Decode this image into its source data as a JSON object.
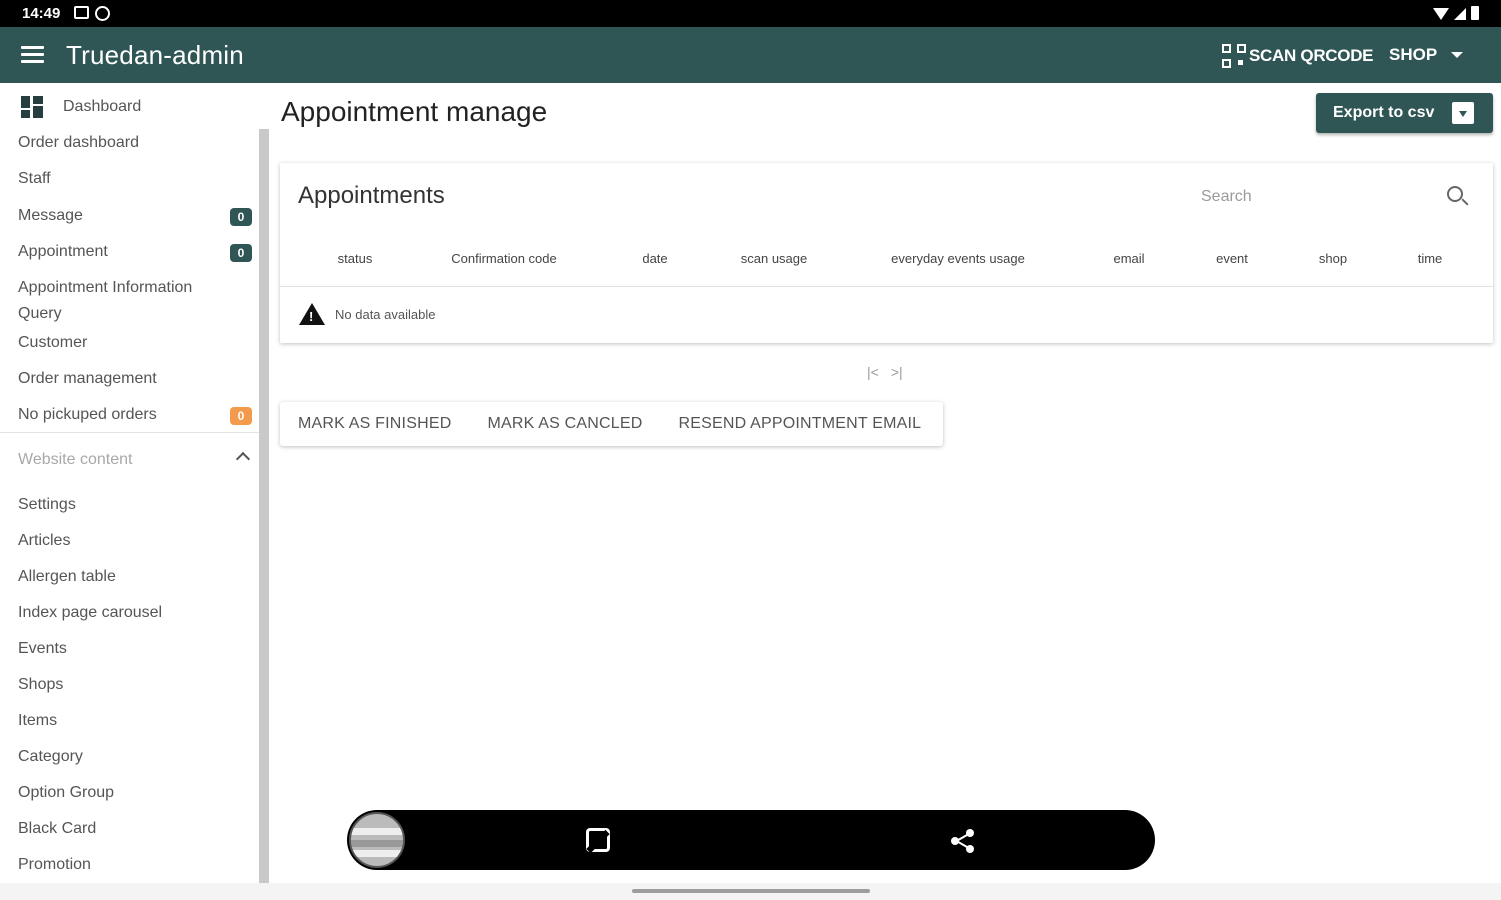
{
  "status_bar": {
    "time": "14:49"
  },
  "appbar": {
    "title": "Truedan-admin",
    "scan_label": "SCAN QRCODE",
    "shop_label": "SHOP",
    "color": "#2f5655"
  },
  "sidebar": {
    "dashboard": "Dashboard",
    "items": [
      {
        "label": "Order dashboard"
      },
      {
        "label": "Staff"
      },
      {
        "label": "Message",
        "badge": "0"
      },
      {
        "label": "Appointment",
        "badge": "0"
      },
      {
        "label": "Appointment Information Query"
      },
      {
        "label": "Customer"
      },
      {
        "label": "Order management"
      },
      {
        "label": "No pickuped orders",
        "badge": "0"
      }
    ],
    "group_label": "Website content",
    "group_items": [
      "Settings",
      "Articles",
      "Allergen table",
      "Index page carousel",
      "Events",
      "Shops",
      "Items",
      "Category",
      "Option Group",
      "Black Card",
      "Promotion"
    ]
  },
  "main": {
    "page_title": "Appointment manage",
    "export_label": "Export to csv",
    "card_title": "Appointments",
    "search_placeholder": "Search",
    "columns": [
      "status",
      "Confirmation code",
      "date",
      "scan usage",
      "everyday events usage",
      "email",
      "event",
      "shop",
      "time"
    ],
    "no_data": "No data available",
    "pager": {
      "first": "|<",
      "last": ">|"
    },
    "actions": [
      "MARK AS FINISHED",
      "MARK AS CANCLED",
      "RESEND APPOINTMENT EMAIL"
    ]
  },
  "icons": [
    "menu-icon",
    "qr-code-icon",
    "chevron-down-icon",
    "dashboard-icon",
    "chevron-up-icon",
    "download-icon",
    "search-icon",
    "warning-icon",
    "rotate-icon",
    "share-icon"
  ]
}
